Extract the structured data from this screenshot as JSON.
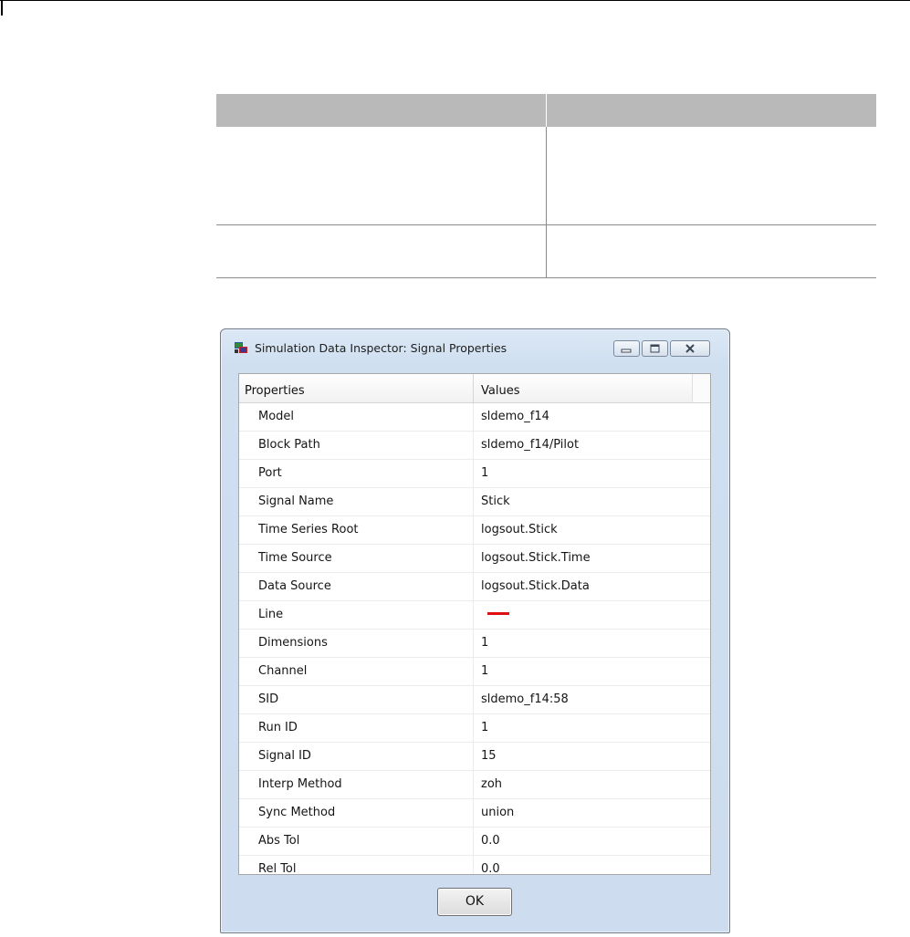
{
  "dialog": {
    "title": "Simulation Data Inspector: Signal Properties",
    "ok_label": "OK",
    "columns": {
      "properties": "Properties",
      "values": "Values"
    },
    "rows": [
      {
        "key": "Model",
        "value": "sldemo_f14"
      },
      {
        "key": "Block Path",
        "value": "sldemo_f14/Pilot"
      },
      {
        "key": "Port",
        "value": "1"
      },
      {
        "key": "Signal Name",
        "value": "Stick"
      },
      {
        "key": "Time Series Root",
        "value": "logsout.Stick"
      },
      {
        "key": "Time Source",
        "value": "logsout.Stick.Time"
      },
      {
        "key": "Data Source",
        "value": "logsout.Stick.Data"
      },
      {
        "key": "Line",
        "value": ""
      },
      {
        "key": "Dimensions",
        "value": "1"
      },
      {
        "key": "Channel",
        "value": "1"
      },
      {
        "key": "SID",
        "value": "sldemo_f14:58"
      },
      {
        "key": "Run ID",
        "value": "1"
      },
      {
        "key": "Signal ID",
        "value": "15"
      },
      {
        "key": "Interp Method",
        "value": "zoh"
      },
      {
        "key": "Sync Method",
        "value": "union"
      },
      {
        "key": "Abs Tol",
        "value": "0.0"
      },
      {
        "key": "Rel Tol",
        "value": "0.0"
      }
    ],
    "line_color": "#e01010",
    "icons": [
      "app-icon",
      "minimize-icon",
      "maximize-icon",
      "close-icon"
    ]
  },
  "doc_table": {
    "header_color": "#b9b9b9"
  }
}
